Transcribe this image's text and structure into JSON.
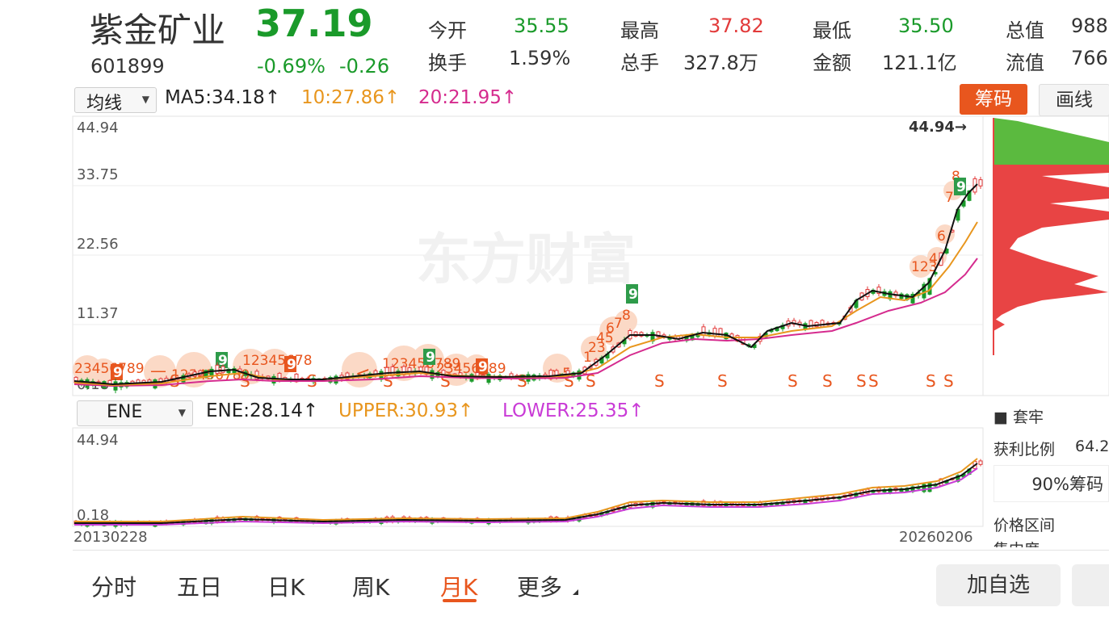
{
  "stock": {
    "name": "紫金矿业",
    "price": "37.19",
    "code": "601899",
    "change_pct": "-0.69%",
    "change_amt": "-0.26"
  },
  "quote": {
    "open_label": "今开",
    "open": "35.55",
    "high_label": "最高",
    "high": "37.82",
    "low_label": "最低",
    "low": "35.50",
    "total_val_label": "总值",
    "total_val": "988",
    "turnover_label": "换手",
    "turnover": "1.59%",
    "volume_label": "总手",
    "volume": "327.8万",
    "amount_label": "金额",
    "amount": "121.1亿",
    "float_val_label": "流值",
    "float_val": "766"
  },
  "main_chart": {
    "indicator_select": "均线",
    "ma5": "MA5:34.18",
    "ma10": "10:27.86",
    "ma20": "20:21.95",
    "up_arrow": "↑",
    "chip_button": "筹码",
    "draw_button": "画线",
    "y_ticks": [
      "44.94",
      "33.75",
      "22.56",
      "11.37",
      "0.18"
    ],
    "max_label": "44.94→",
    "watermark": "东方财富",
    "signal_letter": "S"
  },
  "sub_chart": {
    "indicator_select": "ENE",
    "ene": "ENE:28.14",
    "upper": "UPPER:30.93",
    "lower": "LOWER:25.35",
    "up_arrow": "↑",
    "y_top": "44.94",
    "y_bottom": "0.18",
    "x_start": "20130228",
    "x_end": "20260206"
  },
  "chip_panel": {
    "legend_trapped": "■ 套牢",
    "profit_label": "获利比例",
    "profit_value": "64.2",
    "chip_pct_button": "90%筹码",
    "price_range_label": "价格区间",
    "concentration_label": "集中度"
  },
  "bottom_tabs": [
    "分时",
    "五日",
    "日K",
    "周K",
    "月K",
    "更多"
  ],
  "active_tab": "月K",
  "add_watch_button": "加自选",
  "colors": {
    "up": "#e23a3a",
    "down": "#1a9a2a",
    "ma10": "#e8961e",
    "ma20": "#d52b8e",
    "chip_btn": "#e8561e"
  }
}
